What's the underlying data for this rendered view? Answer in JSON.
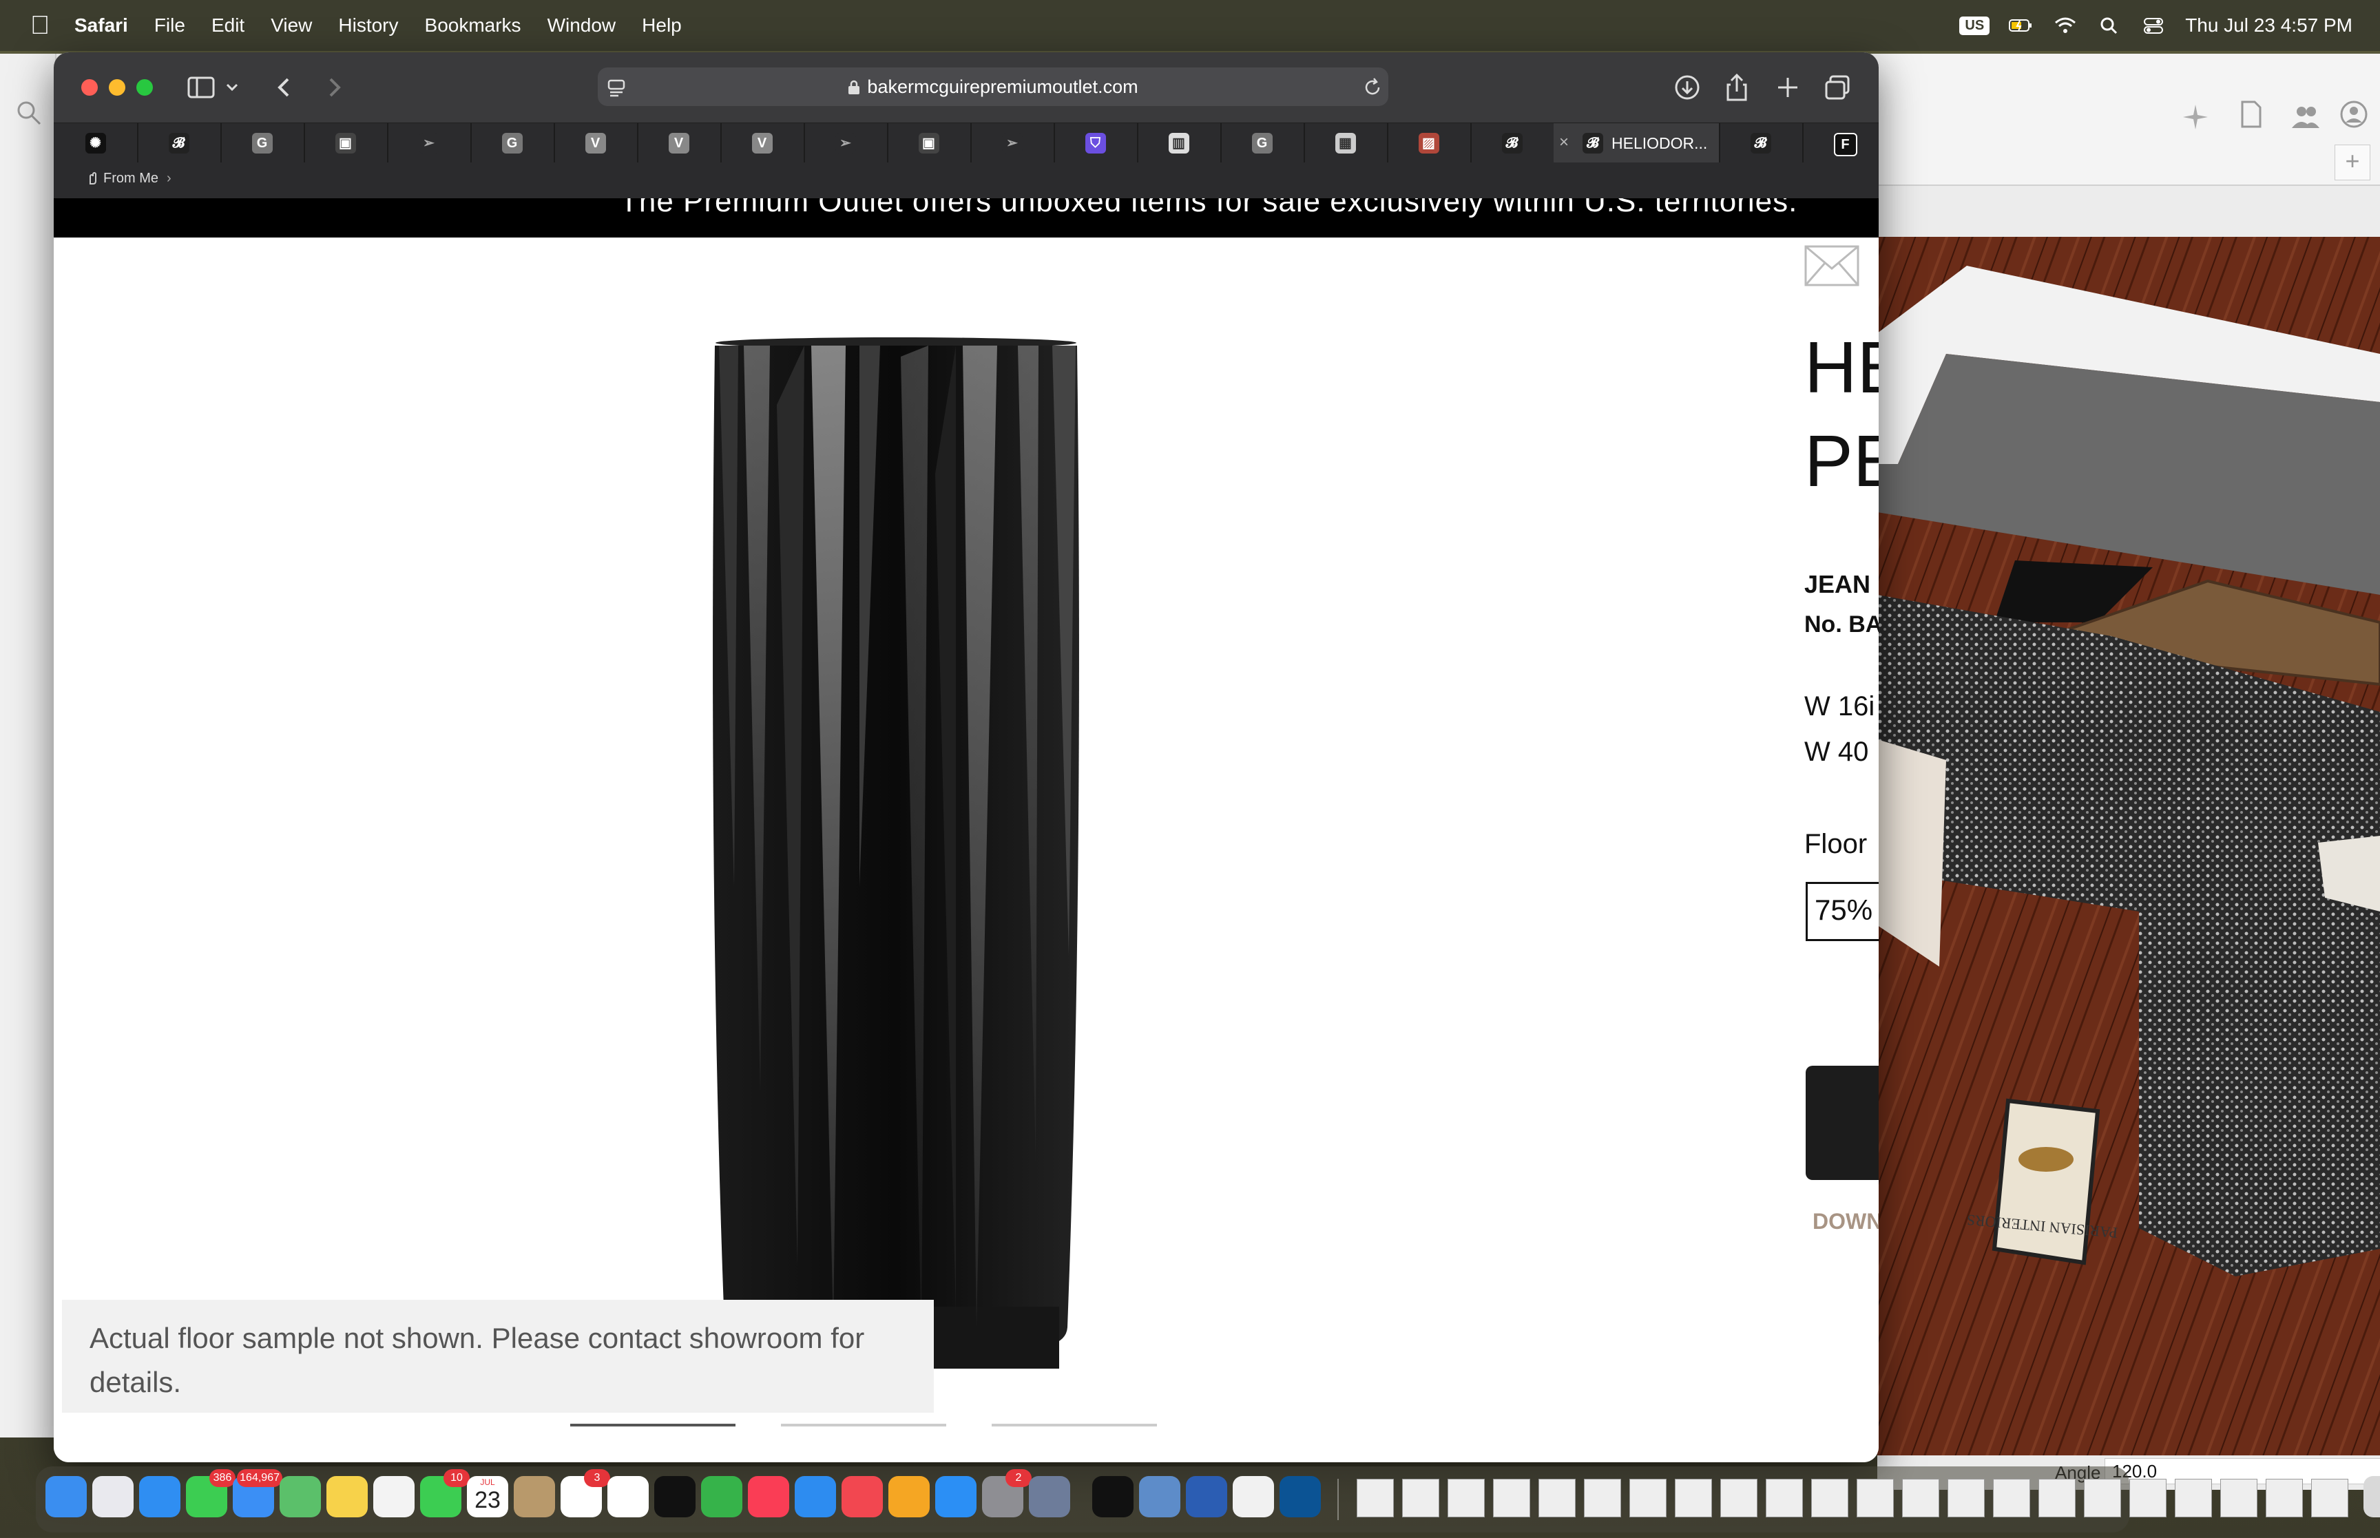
{
  "menubar": {
    "app_name": "Safari",
    "items": [
      "File",
      "Edit",
      "View",
      "History",
      "Bookmarks",
      "Window",
      "Help"
    ],
    "input_source": "US",
    "datetime": "Thu Jul 23  4:57 PM"
  },
  "safari": {
    "url": "bakermcguirepremiumoutlet.com",
    "tabs": [
      {
        "icon": "openai-icon"
      },
      {
        "icon": "baker-logo-icon"
      },
      {
        "icon": "google-icon",
        "glyph": "G"
      },
      {
        "icon": "frame-icon"
      },
      {
        "icon": "bird-icon"
      },
      {
        "icon": "google-icon",
        "glyph": "G"
      },
      {
        "icon": "v-icon",
        "glyph": "V"
      },
      {
        "icon": "v-icon",
        "glyph": "V"
      },
      {
        "icon": "v-icon",
        "glyph": "V"
      },
      {
        "icon": "bird-icon"
      },
      {
        "icon": "frame-icon"
      },
      {
        "icon": "bird-icon"
      },
      {
        "icon": "shield-icon"
      },
      {
        "icon": "pattern-icon"
      },
      {
        "icon": "google-icon",
        "glyph": "G"
      },
      {
        "icon": "grid-icon"
      },
      {
        "icon": "red-pattern-icon"
      },
      {
        "icon": "baker-logo-icon"
      }
    ],
    "active_tab_title": "HELIODOR...",
    "after_tabs": [
      {
        "icon": "baker-logo-icon"
      },
      {
        "icon": "f-icon",
        "glyph": "F"
      }
    ],
    "bookmark": "From Me"
  },
  "page": {
    "promo": "The Premium Outlet offers unboxed items for sale exclusively within U.S. territories.",
    "caption": "Actual floor sample not shown. Please contact showroom for details.",
    "product": {
      "title_line1": "HE",
      "title_line2": "PE",
      "designer": "JEAN",
      "number": "No. BA",
      "dim1": "W 16i",
      "dim2": "W 40",
      "floor_label": "Floor",
      "discount": "75%",
      "download": "DOWN"
    }
  },
  "sketchup": {
    "angle_label": "Angle",
    "angle_value": "120.0",
    "book_title": "PARISIAN INTERIORS"
  },
  "dock": {
    "badges": {
      "messages": "386",
      "mail": "164,967",
      "calendar_month": "JUL",
      "calendar_day": "23",
      "facetime": "10",
      "reminders": "3",
      "settings": "2"
    }
  }
}
